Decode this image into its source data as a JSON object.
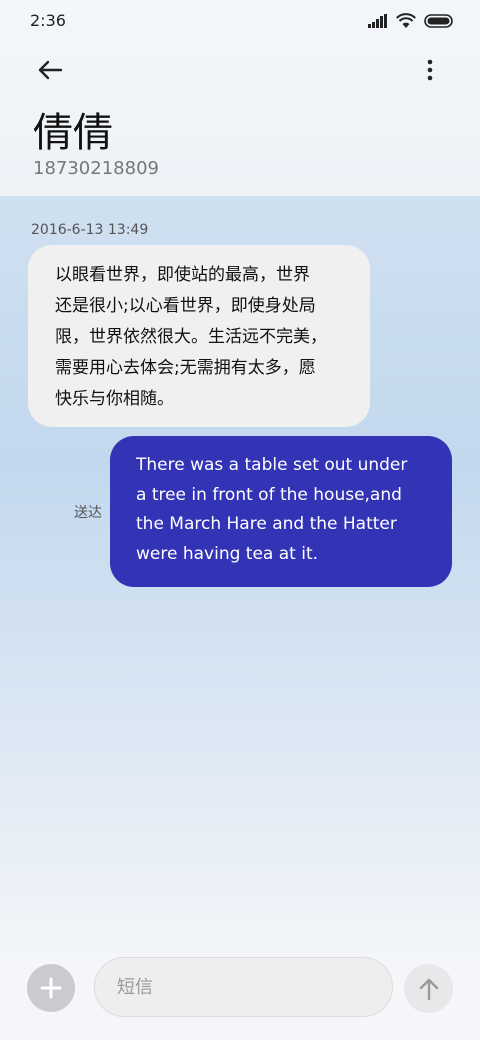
{
  "status_bar": {
    "time": "2:36",
    "icons": [
      "signal-icon",
      "wifi-icon",
      "battery-icon"
    ]
  },
  "header": {
    "contact_name": "倩倩",
    "contact_number": "18730218809",
    "back_icon": "back-arrow-icon",
    "more_icon": "more-vertical-icon"
  },
  "conversation": {
    "timestamp": "2016-6-13 13:49",
    "incoming_message": {
      "lines": [
        "以眼看世界，即使站的最高，世界",
        "还是很小;以心看世界，即使身处局",
        "限，世界依然很大。生活远不完美，",
        "需要用心去体会;无需拥有太多，愿",
        "快乐与你相随。"
      ]
    },
    "outgoing_message": {
      "lines": [
        "There was a table set out under",
        "a tree in front of the house,and",
        "the March Hare and the Hatter",
        "were having tea at it."
      ],
      "status": "送达"
    }
  },
  "composer": {
    "placeholder": "短信",
    "value": "",
    "add_icon": "plus-icon",
    "send_icon": "send-arrow-icon"
  },
  "colors": {
    "outgoing_bubble": "#3233b5",
    "incoming_bubble": "#f0f0f0",
    "header_bg": "#f3f6fa",
    "conversation_bg": "#c3d8ee"
  }
}
